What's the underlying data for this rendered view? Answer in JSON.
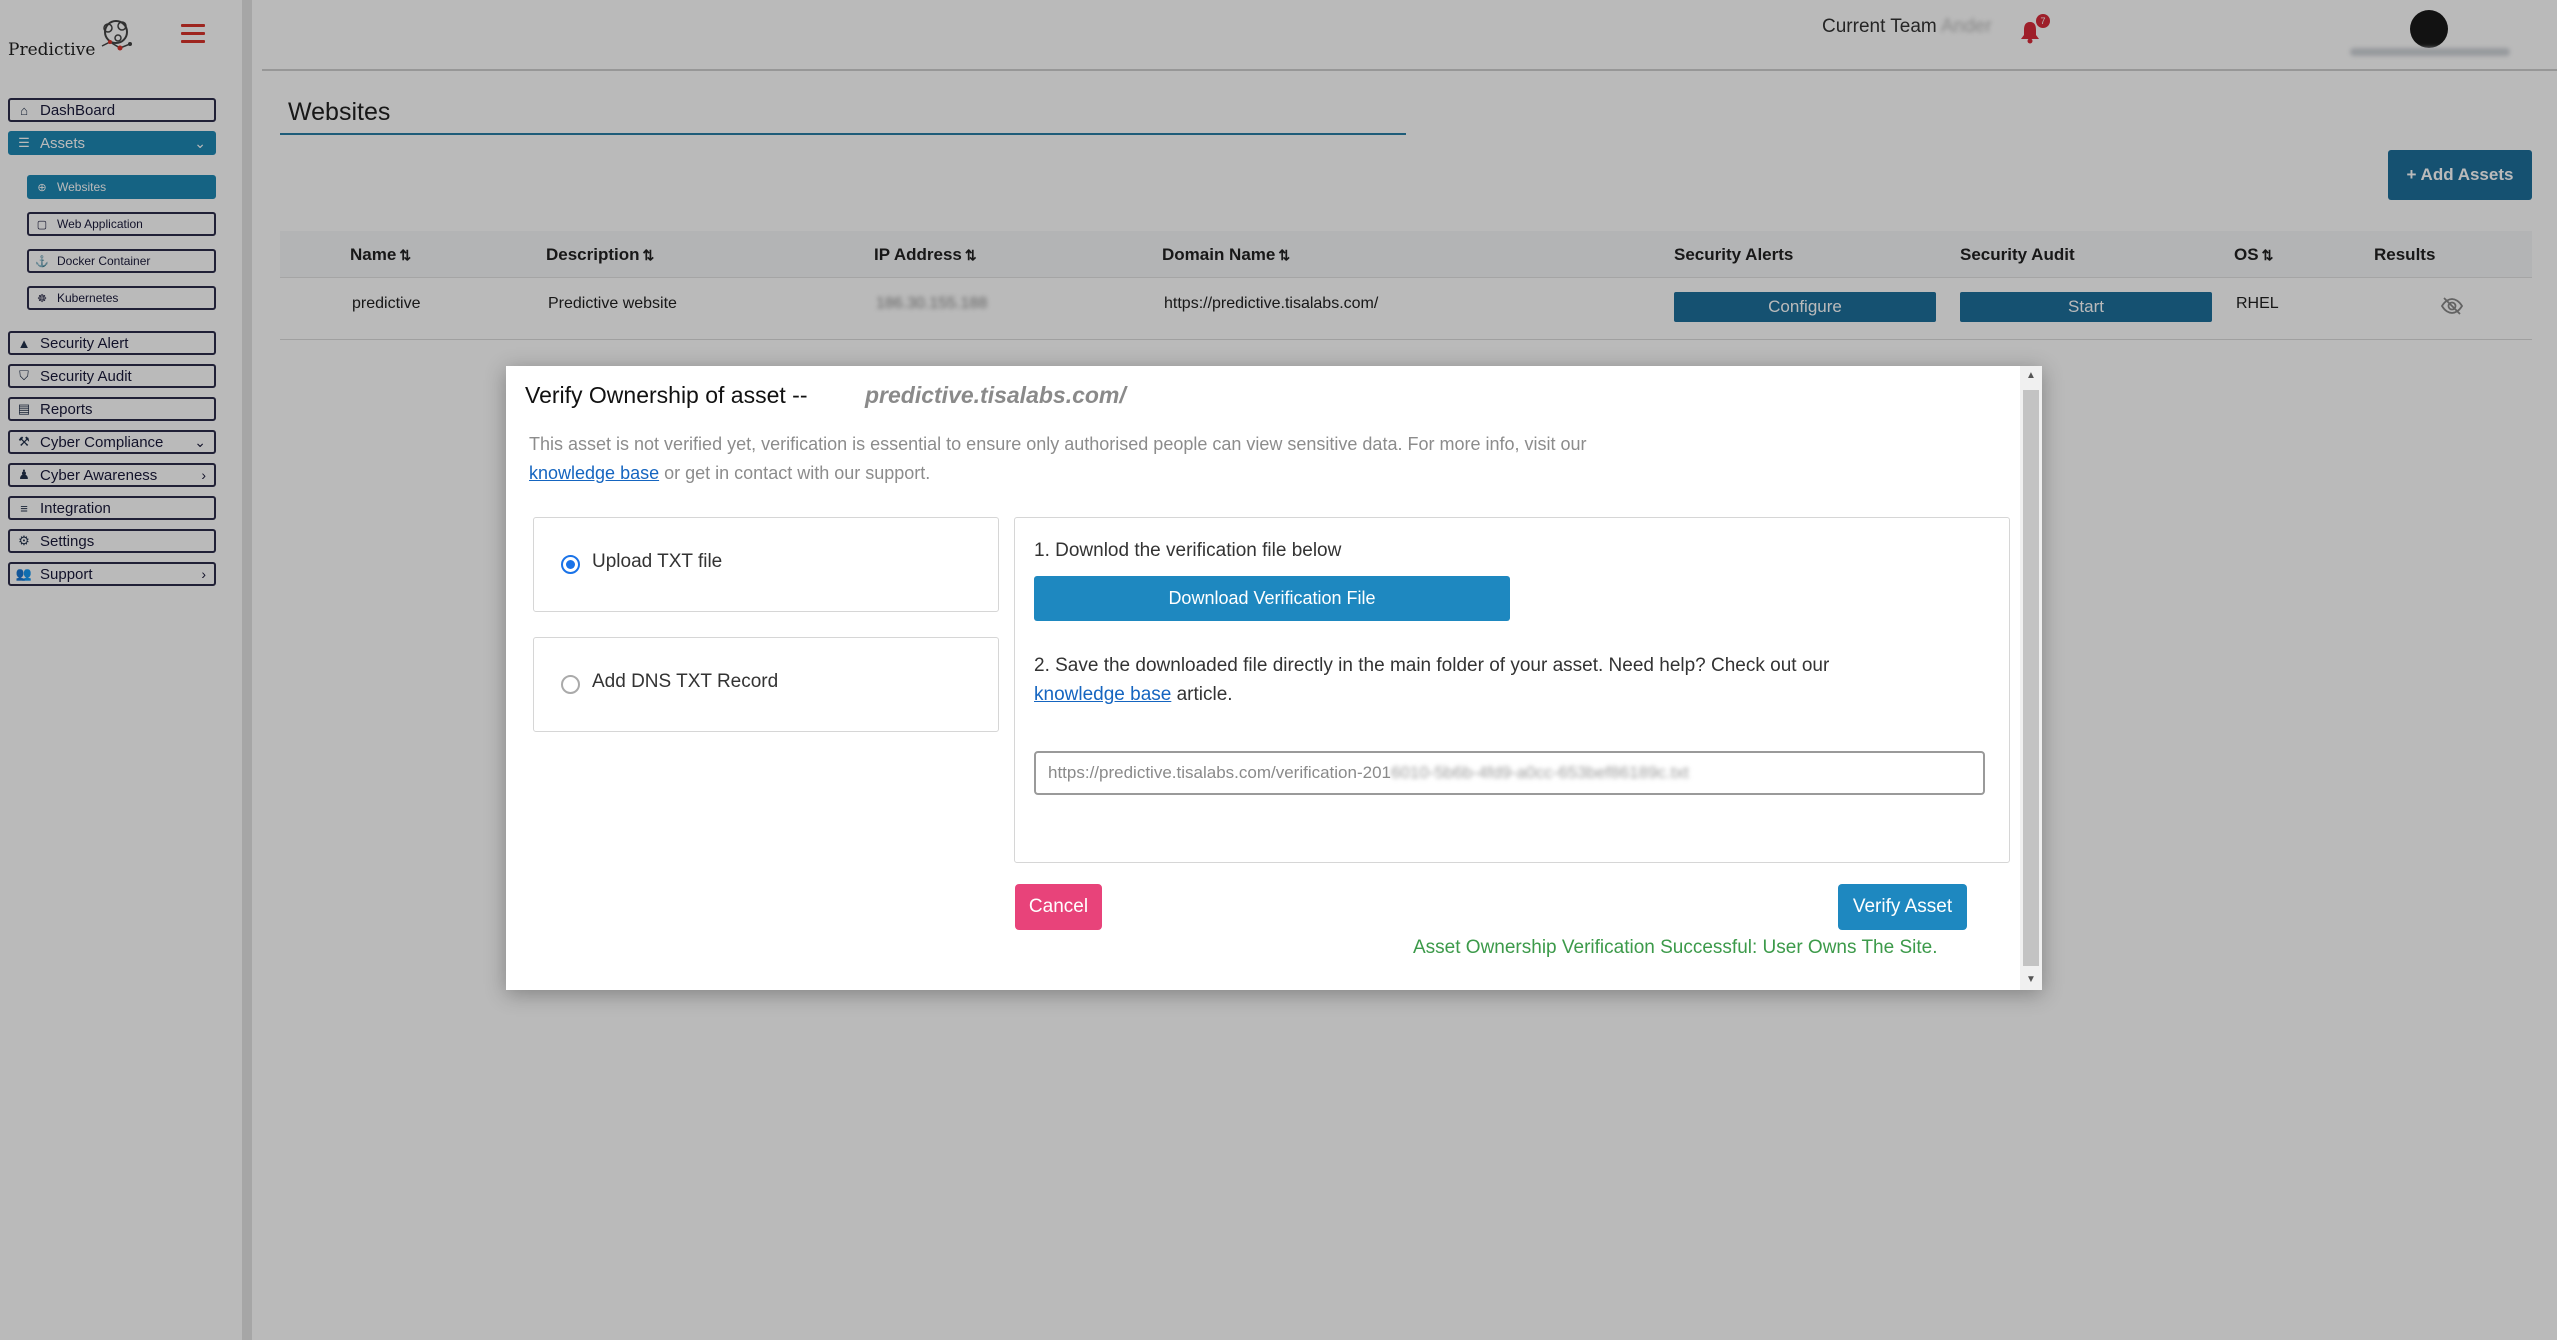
{
  "brand": {
    "name": "Predictive"
  },
  "sidebar": {
    "items": [
      {
        "label": "DashBoard",
        "icon": "home-icon"
      },
      {
        "label": "Assets",
        "icon": "list-icon",
        "expanded": true
      },
      {
        "label": "Security Alert",
        "icon": "warning-icon"
      },
      {
        "label": "Security Audit",
        "icon": "shield-icon"
      },
      {
        "label": "Reports",
        "icon": "document-icon"
      },
      {
        "label": "Cyber Compliance",
        "icon": "gavel-icon"
      },
      {
        "label": "Cyber Awareness",
        "icon": "people-icon"
      },
      {
        "label": "Integration",
        "icon": "sliders-icon"
      },
      {
        "label": "Settings",
        "icon": "gear-icon"
      },
      {
        "label": "Support",
        "icon": "users-icon"
      }
    ],
    "sub_items": [
      {
        "label": "Websites",
        "icon": "globe-icon"
      },
      {
        "label": "Web Application",
        "icon": "window-icon"
      },
      {
        "label": "Docker Container",
        "icon": "anchor-icon"
      },
      {
        "label": "Kubernetes",
        "icon": "helm-icon"
      }
    ]
  },
  "header": {
    "team_label": "Current Team",
    "team_name": "Ander",
    "notification_count": "7"
  },
  "page": {
    "title": "Websites",
    "add_button": "+ Add Assets"
  },
  "table": {
    "columns": [
      "Name",
      "Description",
      "IP Address",
      "Domain Name",
      "Security Alerts",
      "Security Audit",
      "OS",
      "Results"
    ],
    "rows": [
      {
        "name": "predictive",
        "description": "Predictive website",
        "ip": "186.30.155.188",
        "domain": "https://predictive.tisalabs.com/",
        "configure": "Configure",
        "start": "Start",
        "os": "RHEL"
      }
    ]
  },
  "modal": {
    "title": "Verify Ownership of asset --",
    "domain": "predictive.tisalabs.com/",
    "desc_prefix": "This asset is not verified yet, verification is essential to ensure only authorised people can view sensitive data. For more info, visit our",
    "desc_link": "knowledge base",
    "desc_suffix": "or get in contact with our support.",
    "options": [
      {
        "label": "Upload TXT file",
        "selected": true
      },
      {
        "label": "Add DNS TXT Record",
        "selected": false
      }
    ],
    "step1": "1. Downlod the verification file below",
    "download_button": "Download Verification File",
    "step2_prefix": "2. Save the downloaded file directly in the main folder of your asset. Need help? Check out our",
    "step2_link": "knowledge base",
    "step2_suffix": "article.",
    "url_visible": "https://predictive.tisalabs.com/verification-201",
    "url_blurred": "6010-5b6b-4fd9-a0cc-653bef86189c.txt",
    "cancel": "Cancel",
    "verify": "Verify Asset",
    "success": "Asset Ownership Verification Successful: User Owns The Site."
  },
  "colors": {
    "primary": "#1e6f9c",
    "accent": "#1e88c0",
    "danger": "#e8437a",
    "success": "#3c9a4a",
    "bell": "#d92b3a"
  }
}
